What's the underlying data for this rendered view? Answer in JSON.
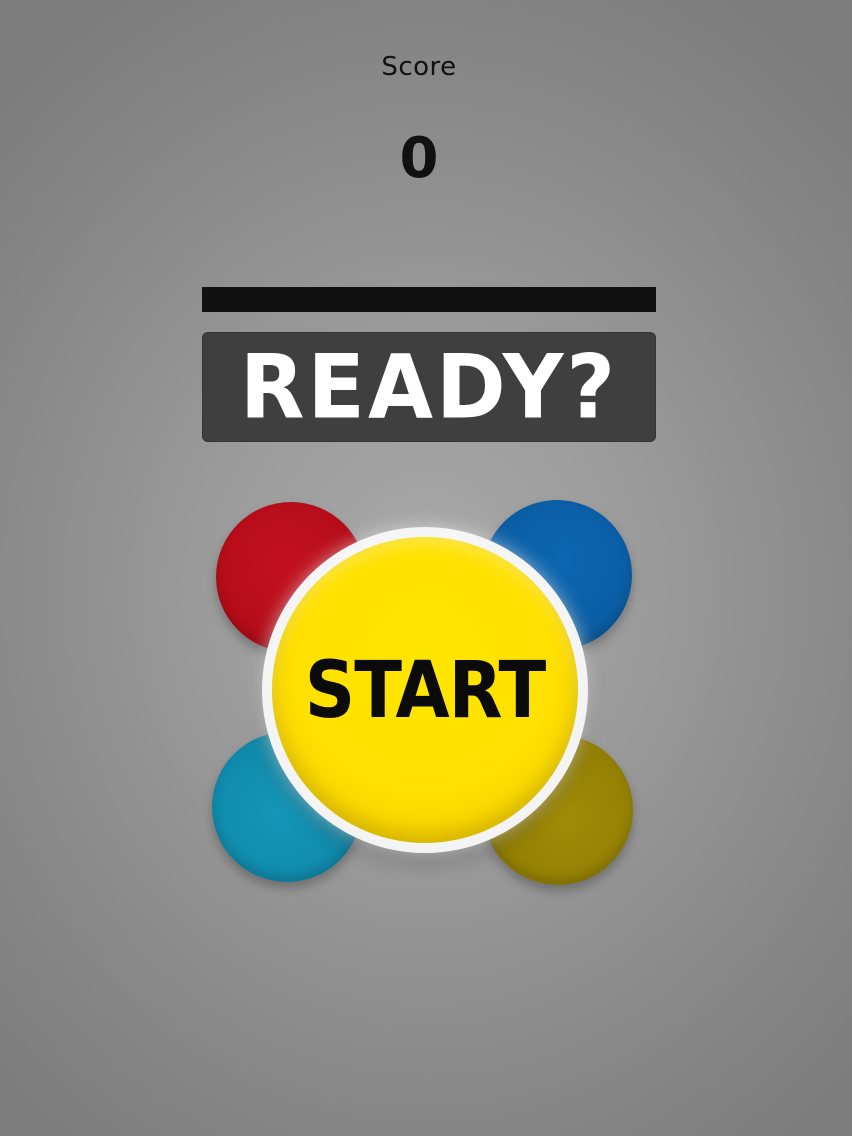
{
  "hud": {
    "score_label": "Score",
    "score_value": "0"
  },
  "timer": {
    "fill_fraction": 1.0,
    "color": "#111111"
  },
  "status": {
    "text": "READY?",
    "panel_color": "#3f3f3f",
    "text_color": "#ffffff"
  },
  "pads": [
    {
      "name": "red",
      "color": "#b20c18"
    },
    {
      "name": "blue",
      "color": "#0a5ca2"
    },
    {
      "name": "cyan",
      "color": "#1089aa"
    },
    {
      "name": "olive",
      "color": "#927f04"
    }
  ],
  "start_button": {
    "label": "START",
    "color": "#ffe000"
  }
}
